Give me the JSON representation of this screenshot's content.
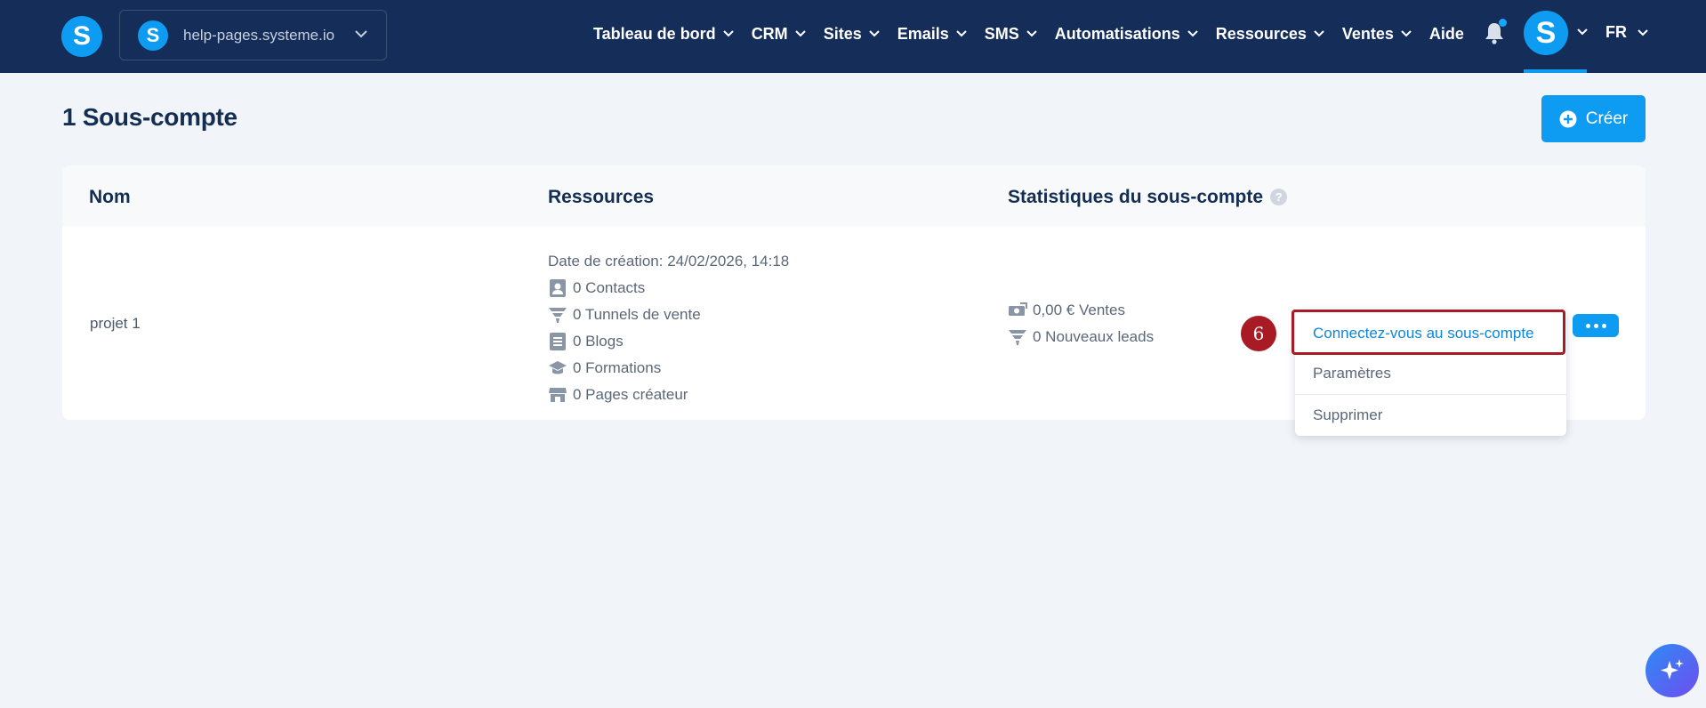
{
  "navbar": {
    "logo_letter": "S",
    "workspace": {
      "logo_letter": "S",
      "name": "help-pages.systeme.io"
    },
    "items": [
      {
        "label": "Tableau de bord"
      },
      {
        "label": "CRM"
      },
      {
        "label": "Sites"
      },
      {
        "label": "Emails"
      },
      {
        "label": "SMS"
      },
      {
        "label": "Automatisations"
      },
      {
        "label": "Ressources"
      },
      {
        "label": "Ventes"
      }
    ],
    "help_label": "Aide",
    "avatar_letter": "S",
    "language": "FR"
  },
  "page": {
    "title": "1 Sous-compte",
    "create_label": "Créer"
  },
  "table": {
    "headers": {
      "name": "Nom",
      "resources": "Ressources",
      "stats": "Statistiques du sous-compte",
      "help_mark": "?"
    },
    "row": {
      "name": "projet 1",
      "created": "Date de création: 24/02/2026, 14:18",
      "resources": [
        {
          "icon": "contacts-icon",
          "text": "0 Contacts"
        },
        {
          "icon": "funnel-icon",
          "text": "0 Tunnels de vente"
        },
        {
          "icon": "blog-icon",
          "text": "0 Blogs"
        },
        {
          "icon": "graduation-cap-icon",
          "text": "0 Formations"
        },
        {
          "icon": "store-icon",
          "text": "0 Pages créateur"
        }
      ],
      "stats": [
        {
          "icon": "money-icon",
          "text": "0,00 € Ventes"
        },
        {
          "icon": "funnel-icon",
          "text": "0 Nouveaux leads"
        }
      ]
    }
  },
  "dropdown": {
    "items": [
      {
        "label": "Connectez-vous au sous-compte"
      },
      {
        "label": "Paramètres"
      },
      {
        "label": "Supprimer"
      }
    ]
  },
  "annotation": {
    "step": "6"
  },
  "colors": {
    "navbar": "#142d59",
    "accent": "#0e9cf2",
    "highlight": "#a81b24",
    "background": "#f1f4f8"
  }
}
